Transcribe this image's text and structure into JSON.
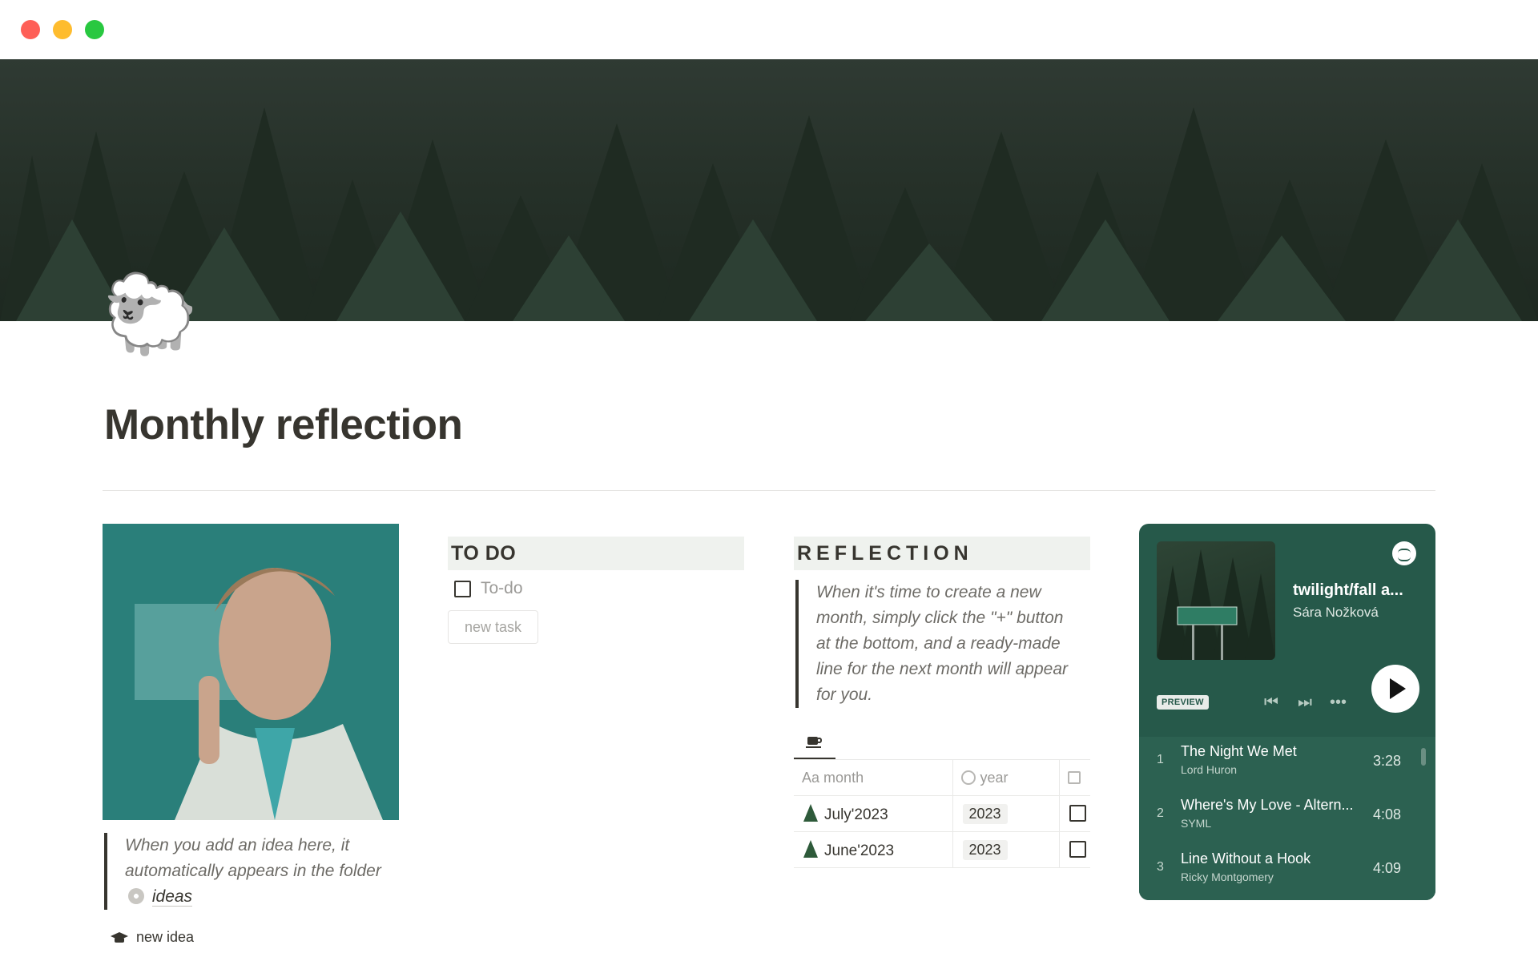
{
  "window": {
    "controls": [
      "close",
      "minimize",
      "zoom"
    ]
  },
  "page": {
    "icon": "🐑",
    "title": "Monthly reflection"
  },
  "ideas_block": {
    "image": "character-portrait-image",
    "quote_text": "When you add an idea here, it automatically appears in the folder",
    "link_label": "ideas",
    "new_idea_label": "new idea"
  },
  "todo": {
    "header": "TO DO",
    "items": [
      {
        "label": "To-do",
        "checked": false
      }
    ],
    "new_task_label": "new task"
  },
  "reflection": {
    "header": "REFLECTION",
    "quote_text": "When it's time to create a new month, simply click the \"+\" button at the bottom, and a ready-made line for the next month will appear for you.",
    "view_tab_icon": "coffee-cup-icon",
    "table": {
      "columns": [
        {
          "prefix": "Aa",
          "label": "month"
        },
        {
          "icon": "select-icon",
          "label": "year"
        },
        {
          "icon": "checkbox-icon",
          "label": ""
        }
      ],
      "rows": [
        {
          "month": "July'2023",
          "year": "2023",
          "done": false
        },
        {
          "month": "June'2023",
          "year": "2023",
          "done": false
        }
      ]
    }
  },
  "spotify": {
    "playlist_title": "twilight/fall a...",
    "owner": "Sára Nožková",
    "preview_label": "PREVIEW",
    "brand_color": "#26594a",
    "tracks": [
      {
        "num": "1",
        "title": "The Night We Met",
        "artist": "Lord Huron",
        "duration": "3:28"
      },
      {
        "num": "2",
        "title": "Where's My Love - Altern...",
        "artist": "SYML",
        "duration": "4:08"
      },
      {
        "num": "3",
        "title": "Line Without a Hook",
        "artist": "Ricky Montgomery",
        "duration": "4:09"
      }
    ]
  }
}
